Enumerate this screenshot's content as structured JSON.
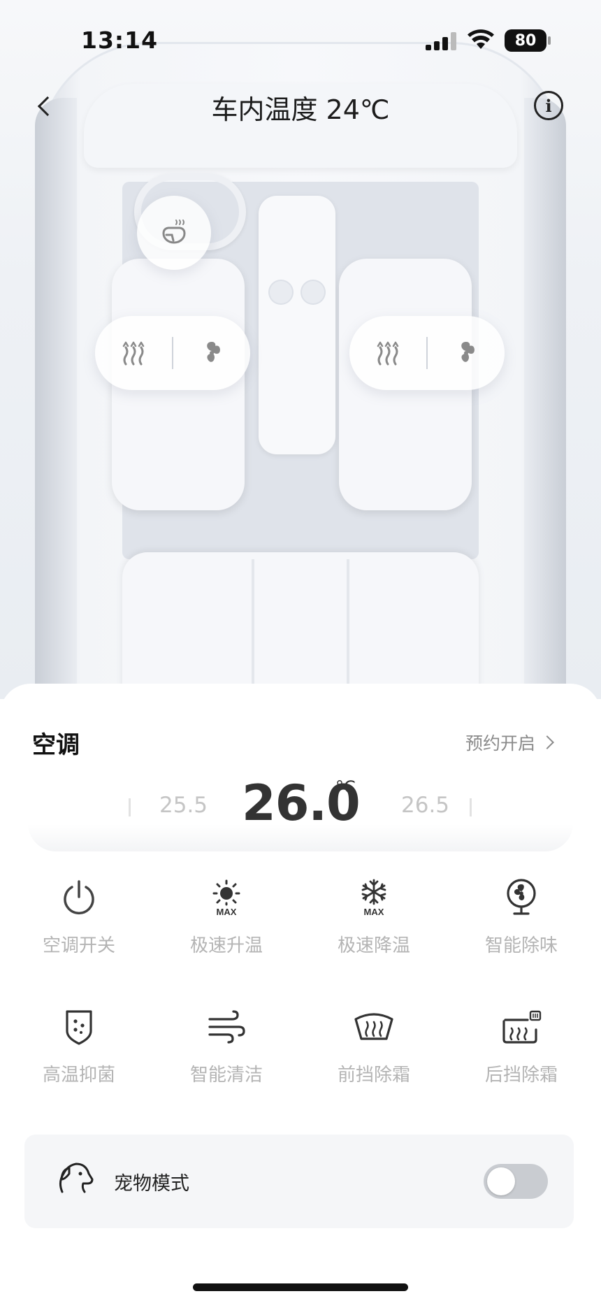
{
  "status_bar": {
    "time": "13:14",
    "battery": "80"
  },
  "header": {
    "title": "车内温度 24℃",
    "back_icon": "chevron-left-icon",
    "info_icon": "info-icon",
    "info_glyph": "i"
  },
  "car_controls": {
    "steering_wheel_heat_icon": "steering-wheel-heat-icon",
    "driver_seat": {
      "heat_icon": "seat-heat-icon",
      "vent_icon": "seat-ventilation-fan-icon"
    },
    "passenger_seat": {
      "heat_icon": "seat-heat-icon",
      "vent_icon": "seat-ventilation-fan-icon"
    }
  },
  "climate": {
    "title": "空调",
    "schedule_label": "预约开启",
    "temp_prev": "25.5",
    "temp_current": "26.0",
    "temp_unit": "°C",
    "temp_next": "26.5"
  },
  "controls": [
    {
      "label": "空调开关",
      "icon": "power-icon"
    },
    {
      "label": "极速升温",
      "icon": "sun-max-icon",
      "badge": "MAX"
    },
    {
      "label": "极速降温",
      "icon": "snowflake-max-icon",
      "badge": "MAX"
    },
    {
      "label": "智能除味",
      "icon": "fan-purifier-icon"
    },
    {
      "label": "高温抑菌",
      "icon": "shield-sterilize-icon"
    },
    {
      "label": "智能清洁",
      "icon": "wind-clean-icon"
    },
    {
      "label": "前挡除霜",
      "icon": "front-defrost-icon"
    },
    {
      "label": "后挡除霜",
      "icon": "rear-defrost-icon"
    }
  ],
  "pet_mode": {
    "label": "宠物模式",
    "icon": "dog-icon",
    "enabled": false
  },
  "colors": {
    "accent_text": "#1f1f1f",
    "muted_label": "#b4b4b4",
    "toggle_off": "#c9ccd1"
  }
}
